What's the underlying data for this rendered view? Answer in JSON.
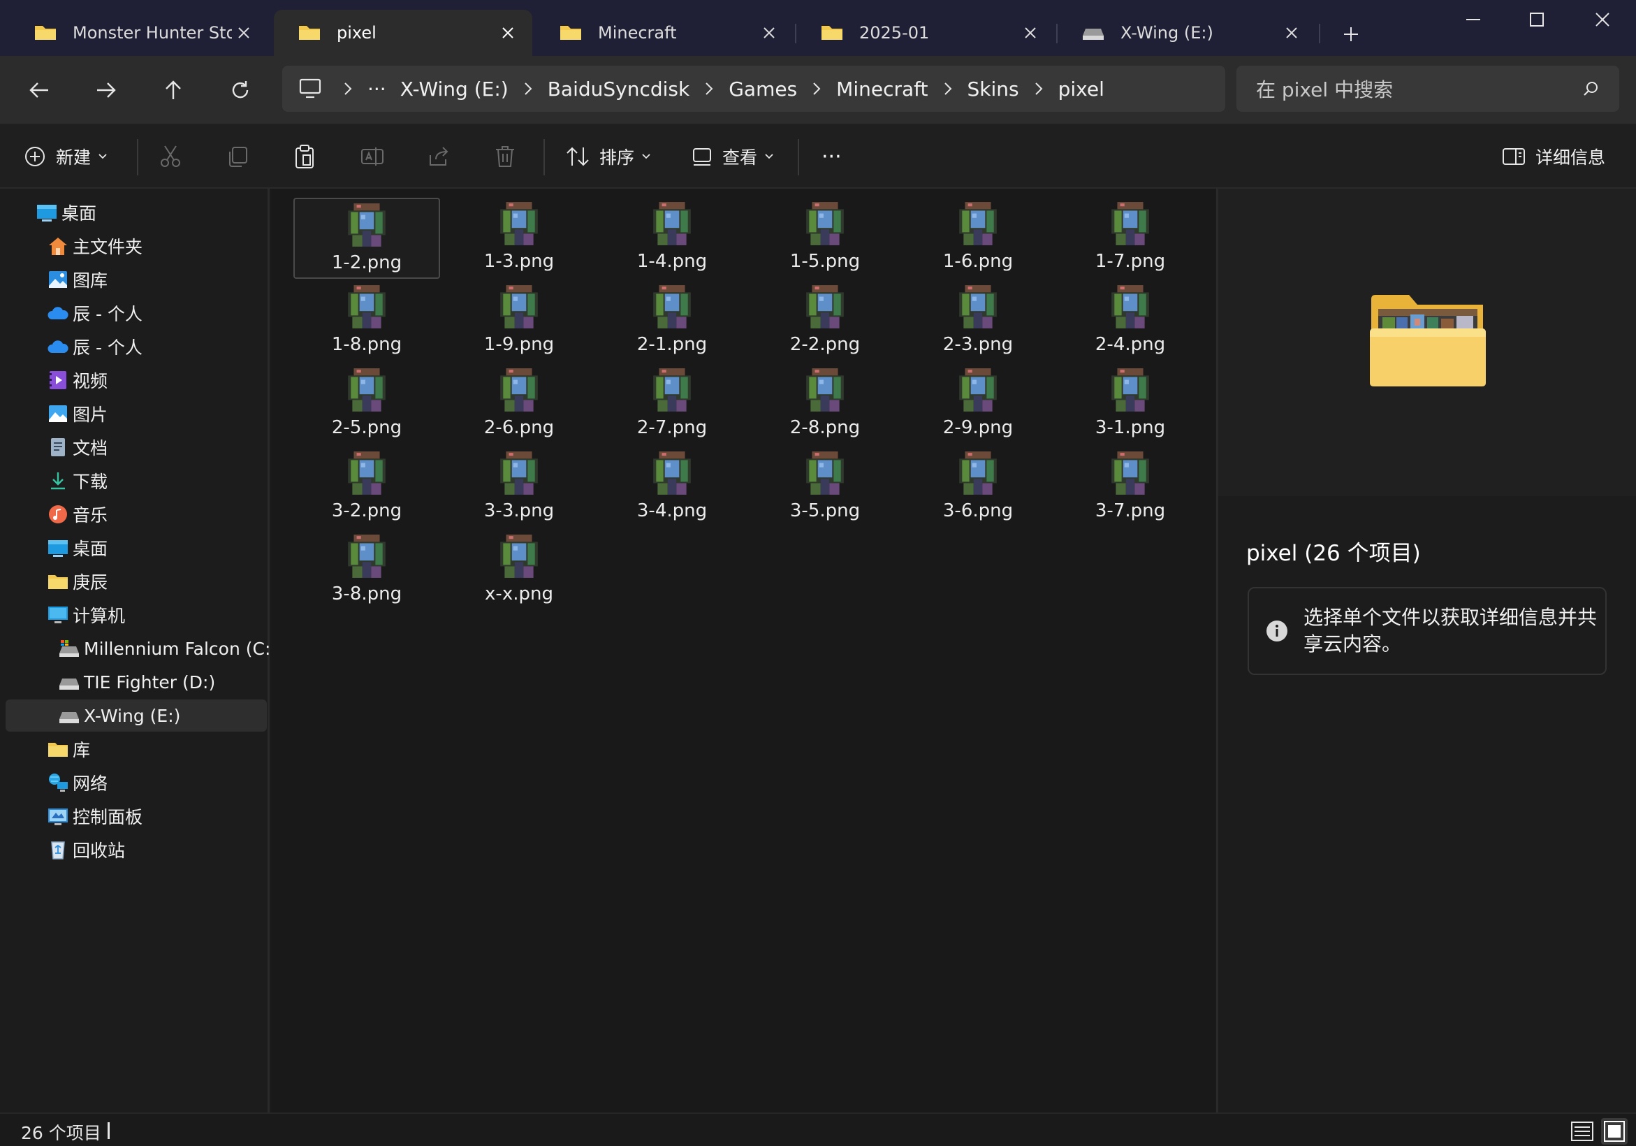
{
  "tabs": [
    {
      "label": "Monster Hunter Stori",
      "icon": "folder-icon"
    },
    {
      "label": "pixel",
      "icon": "folder-icon"
    },
    {
      "label": "Minecraft",
      "icon": "folder-icon"
    },
    {
      "label": "2025-01",
      "icon": "folder-icon"
    },
    {
      "label": "X-Wing (E:)",
      "icon": "drive-icon"
    }
  ],
  "active_tab": "pixel",
  "breadcrumb": {
    "overflow": "···",
    "items": [
      "X-Wing (E:)",
      "BaiduSyncdisk",
      "Games",
      "Minecraft",
      "Skins",
      "pixel"
    ]
  },
  "search": {
    "placeholder": "在 pixel 中搜索"
  },
  "commands": {
    "new_label": "新建",
    "sort_label": "排序",
    "view_label": "查看",
    "more_label": "···",
    "details_label": "详细信息"
  },
  "sidebar": {
    "items": [
      {
        "label": "桌面",
        "icon": "desktop-icon"
      },
      {
        "label": "主文件夹",
        "icon": "home-icon"
      },
      {
        "label": "图库",
        "icon": "gallery-icon"
      },
      {
        "label": "辰 - 个人",
        "icon": "onedrive-icon"
      },
      {
        "label": "辰 - 个人",
        "icon": "onedrive-icon"
      },
      {
        "label": "视频",
        "icon": "videos-icon"
      },
      {
        "label": "图片",
        "icon": "pictures-icon"
      },
      {
        "label": "文档",
        "icon": "documents-icon"
      },
      {
        "label": "下载",
        "icon": "downloads-icon"
      },
      {
        "label": "音乐",
        "icon": "music-icon"
      },
      {
        "label": "桌面",
        "icon": "desktop-icon"
      },
      {
        "label": "庚辰",
        "icon": "folder-icon"
      },
      {
        "label": "计算机",
        "icon": "computer-icon"
      },
      {
        "label": "Millennium Falcon (C:)",
        "icon": "system-drive-icon"
      },
      {
        "label": "TIE Fighter (D:)",
        "icon": "drive-icon"
      },
      {
        "label": "X-Wing (E:)",
        "icon": "drive-icon"
      },
      {
        "label": "库",
        "icon": "folder-icon"
      },
      {
        "label": "网络",
        "icon": "network-icon"
      },
      {
        "label": "控制面板",
        "icon": "control-panel-icon"
      },
      {
        "label": "回收站",
        "icon": "recycle-bin-icon"
      }
    ],
    "selected": "X-Wing (E:)"
  },
  "files": [
    "1-2.png",
    "1-3.png",
    "1-4.png",
    "1-5.png",
    "1-6.png",
    "1-7.png",
    "1-8.png",
    "1-9.png",
    "2-1.png",
    "2-2.png",
    "2-3.png",
    "2-4.png",
    "2-5.png",
    "2-6.png",
    "2-7.png",
    "2-8.png",
    "2-9.png",
    "3-1.png",
    "3-2.png",
    "3-3.png",
    "3-4.png",
    "3-5.png",
    "3-6.png",
    "3-7.png",
    "3-8.png",
    "x-x.png"
  ],
  "selected_file": "1-2.png",
  "details": {
    "title": "pixel (26 个项目)",
    "info": "选择单个文件以获取详细信息并共享云内容。"
  },
  "status": {
    "count": "26 个项目"
  },
  "colors": {
    "folder": "#f2c94c",
    "accent": "#4cc2ff",
    "onedrive": "#2b8cf0"
  }
}
